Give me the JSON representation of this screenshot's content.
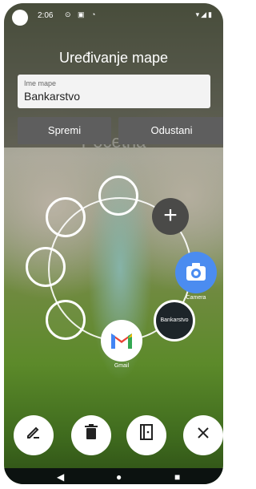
{
  "status_bar": {
    "time": "2:06",
    "icons_left": "⊙ ▣ ◔",
    "icons_right": "▾◢▮"
  },
  "header": {
    "title": "Uređivanje mape"
  },
  "form": {
    "field_label": "Ime mape",
    "field_value": "Bankarstvo",
    "save_label": "Spremi",
    "cancel_label": "Odustani"
  },
  "background_title": "Početna",
  "ring": {
    "add_label": "+",
    "apps": [
      {
        "name": "Camera",
        "label": "Camera"
      },
      {
        "name": "Bankarstvo",
        "label": "Bankarstvo"
      },
      {
        "name": "Gmail",
        "label": "Gmail"
      }
    ]
  },
  "toolbar": [
    "edit-icon",
    "delete-icon",
    "exit-icon",
    "close-icon"
  ],
  "nav_bar": {
    "back": "◀",
    "home": "●",
    "recents": "■"
  },
  "colors": {
    "camera": "#4b8cf0",
    "bank": "#1d2529",
    "add_button": "#4a4a48"
  }
}
